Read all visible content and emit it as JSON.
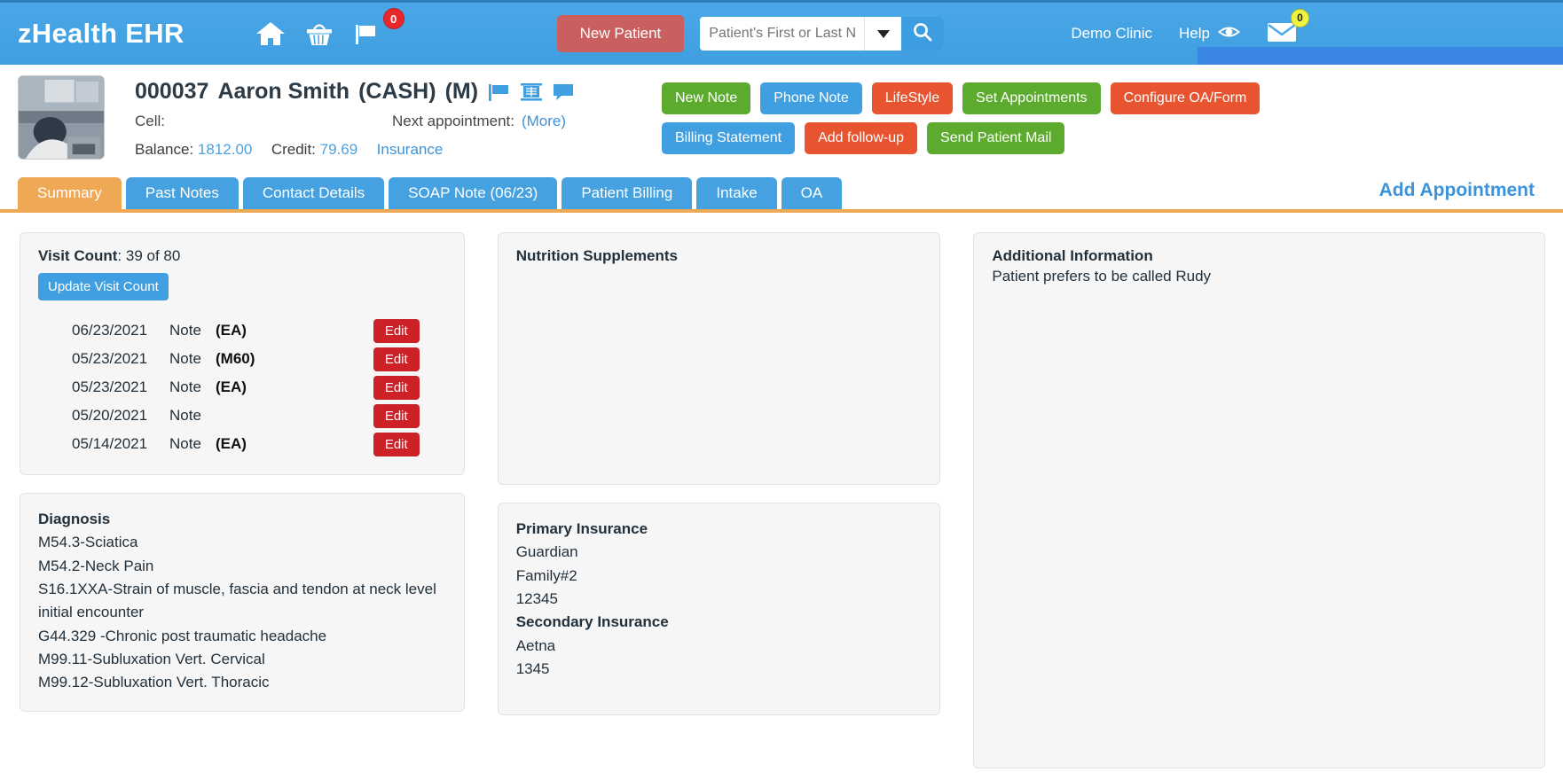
{
  "topbar": {
    "brand": "zHealth EHR",
    "icons": [
      "home-icon",
      "basket-icon",
      "flag-icon"
    ],
    "flag_badge": "0",
    "new_patient_label": "New Patient",
    "search_placeholder": "Patient's First or Last Name",
    "search_value": "",
    "clinic_label": "Demo Clinic",
    "help_label": "Help",
    "mail_badge": "0",
    "accent_blue": "#3f9fe0",
    "accent_red": "#c9605f"
  },
  "patient": {
    "id": "000037",
    "name": "Aaron Smith",
    "payer_tag": "(CASH)",
    "gender_tag": "(M)",
    "icons": [
      "flag-icon",
      "xray-icon",
      "comment-icon"
    ],
    "cell_label": "Cell:",
    "cell_value": "",
    "next_appointment_label": "Next appointment:",
    "next_appointment_value": "",
    "more_link": "(More)",
    "balance_label": "Balance:",
    "balance_value": "1812.00",
    "credit_label": "Credit:",
    "credit_value": "79.69",
    "insurance_link": "Insurance"
  },
  "actions": [
    {
      "label": "New Note",
      "color": "g"
    },
    {
      "label": "Phone Note",
      "color": "b"
    },
    {
      "label": "LifeStyle",
      "color": "o"
    },
    {
      "label": "Set Appointments",
      "color": "g"
    },
    {
      "label": "Configure OA/Form",
      "color": "o"
    },
    {
      "label": "Billing Statement",
      "color": "b"
    },
    {
      "label": "Add follow-up",
      "color": "o"
    },
    {
      "label": "Send Patient Mail",
      "color": "g"
    }
  ],
  "tabs": [
    {
      "label": "Summary",
      "active": true
    },
    {
      "label": "Past Notes",
      "active": false
    },
    {
      "label": "Contact Details",
      "active": false
    },
    {
      "label": "SOAP Note (06/23)",
      "active": false
    },
    {
      "label": "Patient Billing",
      "active": false
    },
    {
      "label": "Intake",
      "active": false
    },
    {
      "label": "OA",
      "active": false
    }
  ],
  "add_appointment_label": "Add Appointment",
  "visit_count": {
    "label": "Visit Count",
    "value": ": 39 of 80",
    "update_button": "Update Visit Count",
    "notes": [
      {
        "date": "06/23/2021",
        "kind": "Note",
        "code": "(EA)",
        "edit": "Edit"
      },
      {
        "date": "05/23/2021",
        "kind": "Note",
        "code": "(M60)",
        "edit": "Edit"
      },
      {
        "date": "05/23/2021",
        "kind": "Note",
        "code": "(EA)",
        "edit": "Edit"
      },
      {
        "date": "05/20/2021",
        "kind": "Note",
        "code": "",
        "edit": "Edit"
      },
      {
        "date": "05/14/2021",
        "kind": "Note",
        "code": "(EA)",
        "edit": "Edit"
      }
    ]
  },
  "diagnosis": {
    "title": "Diagnosis",
    "items": [
      "M54.3-Sciatica",
      "M54.2-Neck Pain",
      "S16.1XXA-Strain of muscle, fascia and tendon at neck level initial encounter",
      "G44.329 -Chronic post traumatic headache",
      "M99.11-Subluxation Vert. Cervical",
      "M99.12-Subluxation Vert. Thoracic"
    ]
  },
  "nutrition": {
    "title": "Nutrition Supplements",
    "items": []
  },
  "insurance": {
    "primary_title": "Primary Insurance",
    "primary_lines": [
      "Guardian",
      "Family#2",
      "12345"
    ],
    "secondary_title": "Secondary Insurance",
    "secondary_lines": [
      "Aetna",
      "1345"
    ]
  },
  "additional": {
    "title": "Additional Information",
    "text": "Patient prefers to be called Rudy"
  }
}
